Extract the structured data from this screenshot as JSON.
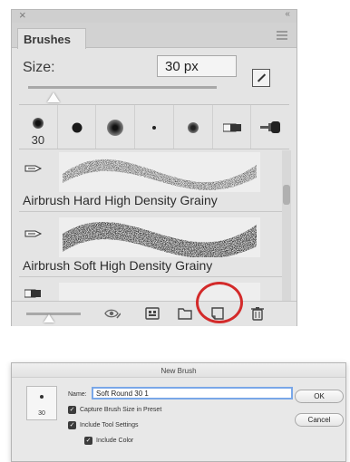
{
  "panel": {
    "close_glyph": "×",
    "collapse_glyph": "‹‹",
    "tab_label": "Brushes",
    "size_label": "Size:",
    "size_value": "30 px",
    "size_slider_fraction": 0.18,
    "presets": [
      {
        "size": "30",
        "icon": "soft-round-brush-icon"
      },
      {
        "size": "",
        "icon": "hard-round-brush-icon"
      },
      {
        "size": "",
        "icon": "soft-round-large-brush-icon"
      },
      {
        "size": "",
        "icon": "small-round-brush-icon"
      },
      {
        "size": "",
        "icon": "soft-round-medium-brush-icon"
      },
      {
        "size": "",
        "icon": "flat-brush-icon"
      },
      {
        "size": "",
        "icon": "airbrush-tip-icon"
      }
    ],
    "brushes": [
      {
        "name": "Airbrush Hard High Density Grainy"
      },
      {
        "name": "Airbrush Soft High Density Grainy"
      },
      {
        "name": ""
      }
    ],
    "footer_icons": [
      "brush-size-slider",
      "visibility-brush-icon",
      "brush-presets-icon",
      "folder-icon",
      "new-brush-icon",
      "trash-icon"
    ],
    "highlight_color": "#d32a2a"
  },
  "dialog": {
    "title": "New Brush",
    "name_label": "Name:",
    "name_value": "Soft Round 30 1",
    "preview_size": "30",
    "ok_label": "OK",
    "cancel_label": "Cancel",
    "checks": [
      {
        "label": "Capture Brush Size in Preset",
        "checked": true
      },
      {
        "label": "Include Tool Settings",
        "checked": true
      },
      {
        "label": "Include Color",
        "checked": true
      }
    ]
  }
}
